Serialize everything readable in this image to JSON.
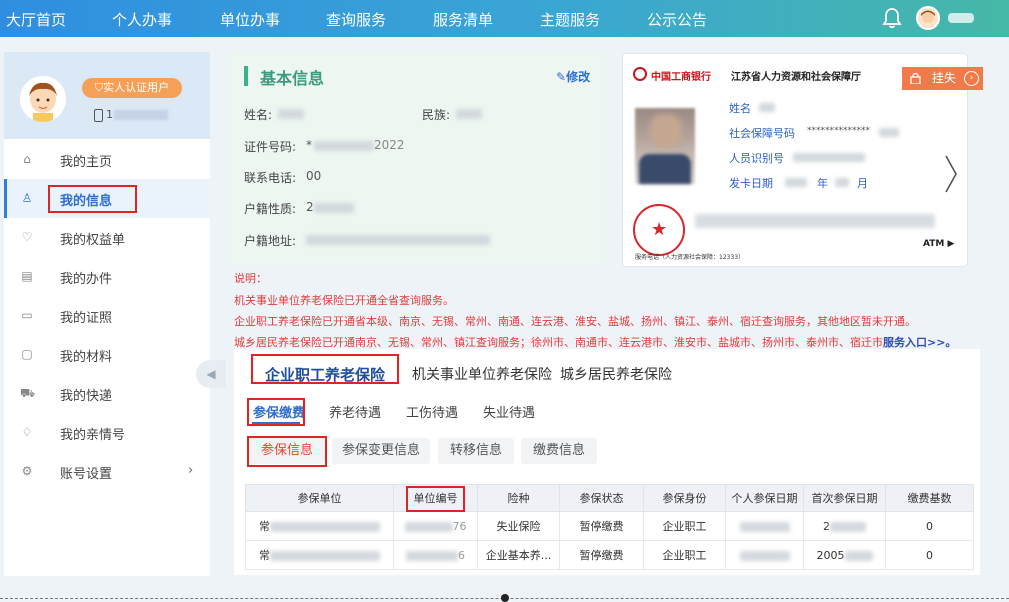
{
  "topnav": {
    "items": [
      "大厅首页",
      "个人办事",
      "单位办事",
      "查询服务",
      "服务清单",
      "主题服务",
      "公示公告"
    ]
  },
  "sidebar": {
    "verify_badge": "实人认证用户",
    "phone_prefix": "1",
    "menu": [
      "我的主页",
      "我的信息",
      "我的权益单",
      "我的办件",
      "我的证照",
      "我的材料",
      "我的快递",
      "我的亲情号",
      "账号设置"
    ],
    "active_index": 1
  },
  "basic_info": {
    "title": "基本信息",
    "edit_label": "修改",
    "name_label": "姓名:",
    "ethnicity_label": "民族:",
    "id_label": "证件号码:",
    "id_value_prefix": "*",
    "id_value_suffix": "2022",
    "phone_label": "联系电话:",
    "phone_value": "00",
    "household_type_label": "户籍性质:",
    "household_type_value": "2",
    "household_addr_label": "户籍地址:"
  },
  "ss_card": {
    "bank_name": "中国工商银行",
    "department": "江苏省人力资源和社会保障厅",
    "name_label": "姓名",
    "ss_number_label": "社会保障号码",
    "ss_number_value": "**************",
    "person_id_label": "人员识别号",
    "issue_date_label": "发卡日期",
    "year_label": "年",
    "month_label": "月",
    "service_line": "服务电话（人力资源社会保障：12333）",
    "atm_label": "ATM ▶",
    "lost_label": "挂失"
  },
  "notes": {
    "title": "说明：",
    "line1": "机关事业单位养老保险已开通全省查询服务。",
    "line2": "企业职工养老保险已开通省本级、南京、无锡、常州、南通、连云港、淮安、盐城、扬州、镇江、泰州、宿迁查询服务，其他地区暂未开通。",
    "line3": "城乡居民养老保险已开通南京、无锡、常州、镇江查询服务；徐州市、南通市、连云港市、淮安市、盐城市、扬州市、泰州市、宿迁市",
    "entry_link": "服务入口>>。"
  },
  "tabs": {
    "main": [
      "企业职工养老保险",
      "机关事业单位养老保险",
      "城乡居民养老保险"
    ],
    "sub": [
      "参保缴费",
      "养老待遇",
      "工伤待遇",
      "失业待遇"
    ],
    "pills": [
      "参保信息",
      "参保变更信息",
      "转移信息",
      "缴费信息"
    ]
  },
  "table": {
    "headers": [
      "参保单位",
      "单位编号",
      "险种",
      "参保状态",
      "参保身份",
      "个人参保日期",
      "首次参保日期",
      "缴费基数"
    ],
    "rows": [
      {
        "unit_prefix": "常",
        "unit_code_suffix": "76",
        "insurance_type": "失业保险",
        "status": "暂停缴费",
        "identity": "企业职工",
        "first_date_prefix": "2",
        "base": "0"
      },
      {
        "unit_prefix": "常",
        "unit_code_suffix": "6",
        "insurance_type": "企业基本养...",
        "status": "暂停缴费",
        "identity": "企业职工",
        "first_date_prefix": "2005",
        "base": "0"
      }
    ]
  },
  "colors": {
    "nav_start": "#2f8ee0",
    "nav_end": "#46b8a8",
    "accent_blue": "#2f6fd0",
    "accent_green": "#3a9c7f",
    "note_red": "#e23b3b",
    "highlight_box": "#e02424",
    "lost_orange": "#f07a4a"
  }
}
